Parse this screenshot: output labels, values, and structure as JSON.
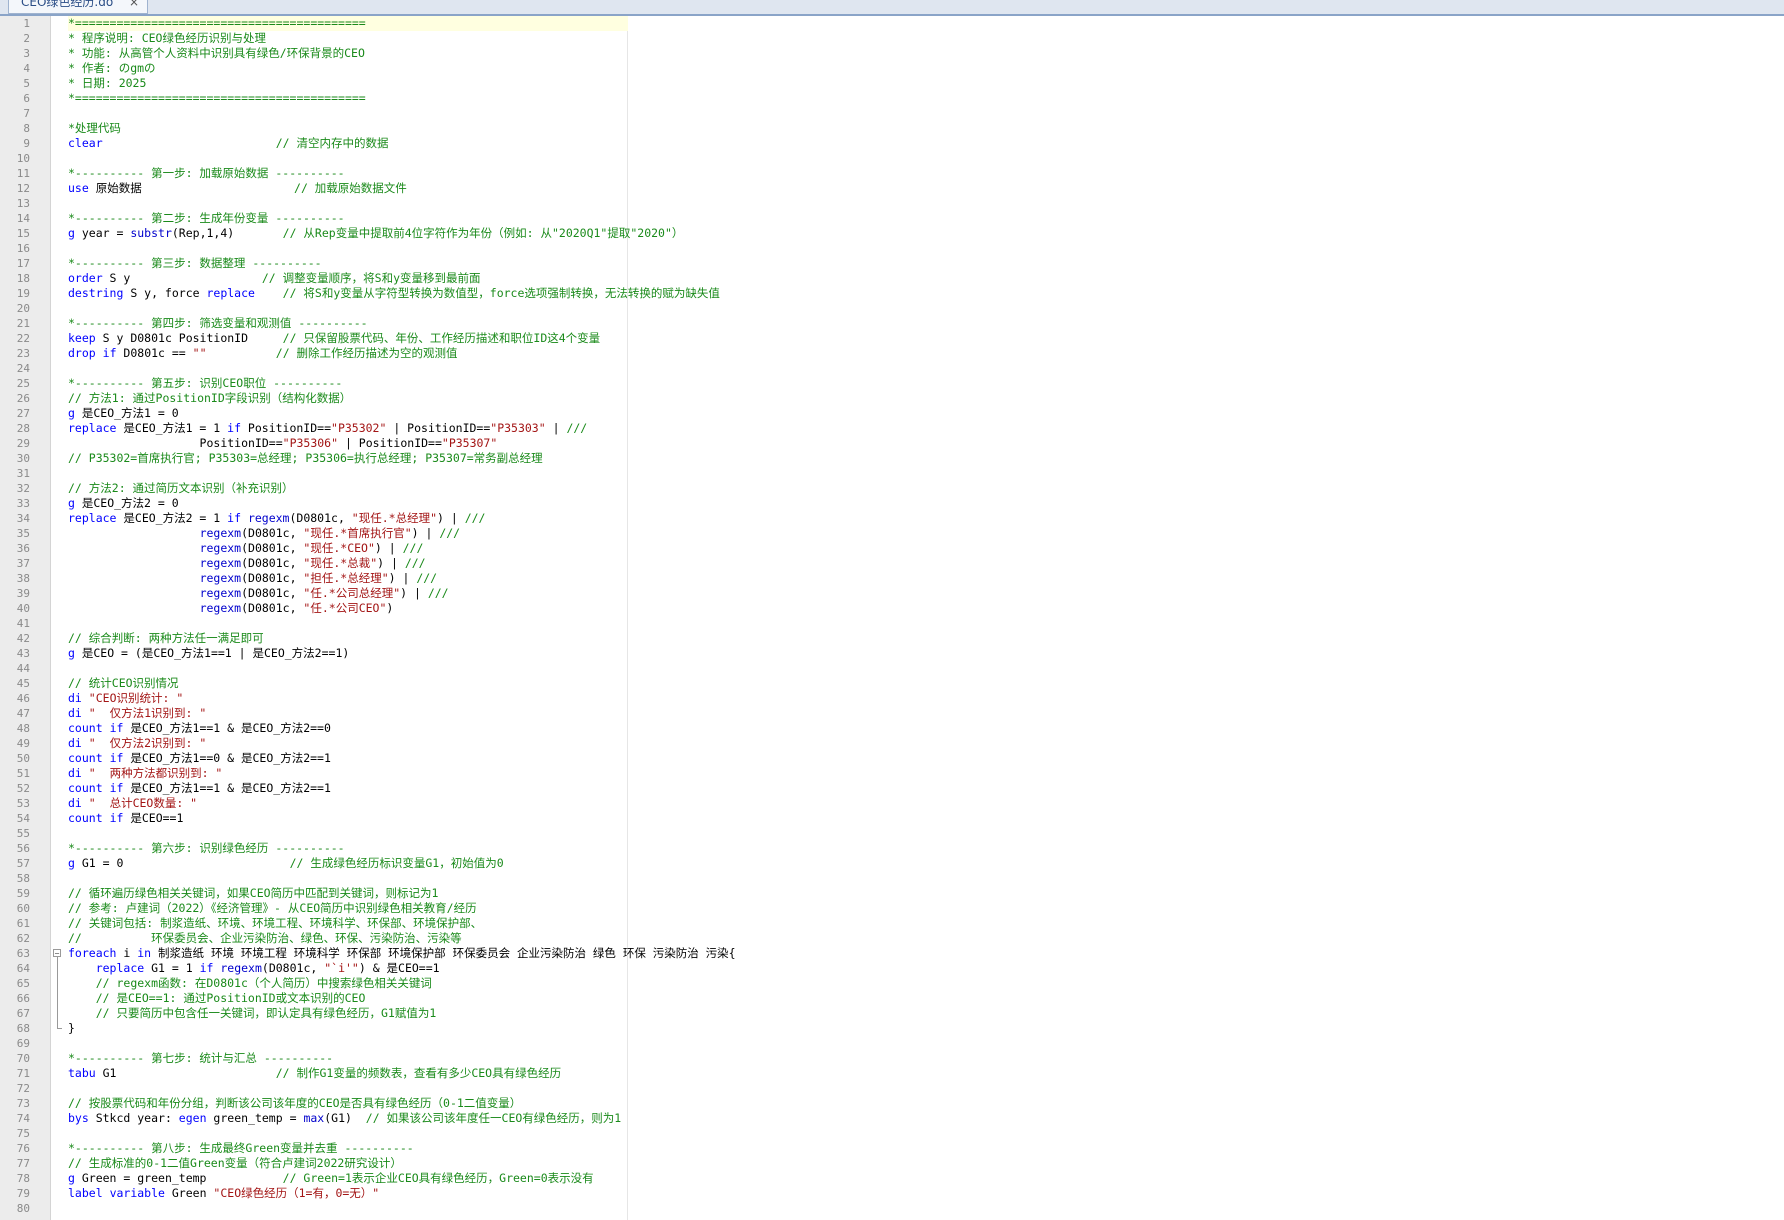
{
  "tab": {
    "title": "CEO绿色经历.do",
    "close": "×"
  },
  "lines": [
    [
      [
        "c",
        "*=========================================="
      ]
    ],
    [
      [
        "c",
        "* 程序说明: CEO绿色经历识别与处理"
      ]
    ],
    [
      [
        "c",
        "* 功能: 从高管个人资料中识别具有绿色/环保背景的CEO"
      ]
    ],
    [
      [
        "c",
        "* 作者: のgmの"
      ]
    ],
    [
      [
        "c",
        "* 日期: 2025"
      ]
    ],
    [
      [
        "c",
        "*=========================================="
      ]
    ],
    [],
    [
      [
        "c",
        "*处理代码"
      ]
    ],
    [
      [
        "k",
        "clear"
      ],
      [
        "t",
        "                         "
      ],
      [
        "c",
        "// 清空内存中的数据"
      ]
    ],
    [],
    [
      [
        "c",
        "*---------- 第一步: 加载原始数据 ----------"
      ]
    ],
    [
      [
        "k",
        "use"
      ],
      [
        "t",
        " 原始数据                      "
      ],
      [
        "c",
        "// 加载原始数据文件"
      ]
    ],
    [],
    [
      [
        "c",
        "*---------- 第二步: 生成年份变量 ----------"
      ]
    ],
    [
      [
        "k",
        "g"
      ],
      [
        "t",
        " year = "
      ],
      [
        "fn",
        "substr"
      ],
      [
        "t",
        "(Rep,1,4)       "
      ],
      [
        "c",
        "// 从Rep变量中提取前4位字符作为年份（例如: 从\"2020Q1\"提取\"2020\"）"
      ]
    ],
    [],
    [
      [
        "c",
        "*---------- 第三步: 数据整理 ----------"
      ]
    ],
    [
      [
        "k",
        "order"
      ],
      [
        "t",
        " S y                   "
      ],
      [
        "c",
        "// 调整变量顺序，将S和y变量移到最前面"
      ]
    ],
    [
      [
        "k",
        "destring"
      ],
      [
        "t",
        " S y, force "
      ],
      [
        "k",
        "replace"
      ],
      [
        "t",
        "    "
      ],
      [
        "c",
        "// 将S和y变量从字符型转换为数值型，force选项强制转换，无法转换的赋为缺失值"
      ]
    ],
    [],
    [
      [
        "c",
        "*---------- 第四步: 筛选变量和观测值 ----------"
      ]
    ],
    [
      [
        "k",
        "keep"
      ],
      [
        "t",
        " S y D0801c PositionID     "
      ],
      [
        "c",
        "// 只保留股票代码、年份、工作经历描述和职位ID这4个变量"
      ]
    ],
    [
      [
        "k",
        "drop"
      ],
      [
        "t",
        " "
      ],
      [
        "k",
        "if"
      ],
      [
        "t",
        " D0801c == "
      ],
      [
        "s",
        "\"\""
      ],
      [
        "t",
        "          "
      ],
      [
        "c",
        "// 删除工作经历描述为空的观测值"
      ]
    ],
    [],
    [
      [
        "c",
        "*---------- 第五步: 识别CEO职位 ----------"
      ]
    ],
    [
      [
        "c",
        "// 方法1: 通过PositionID字段识别（结构化数据）"
      ]
    ],
    [
      [
        "k",
        "g"
      ],
      [
        "t",
        " 是CEO_方法1 = 0"
      ]
    ],
    [
      [
        "k",
        "replace"
      ],
      [
        "t",
        " 是CEO_方法1 = 1 "
      ],
      [
        "k",
        "if"
      ],
      [
        "t",
        " PositionID=="
      ],
      [
        "s",
        "\"P35302\""
      ],
      [
        "t",
        " | PositionID=="
      ],
      [
        "s",
        "\"P35303\""
      ],
      [
        "t",
        " | "
      ],
      [
        "c",
        "///"
      ]
    ],
    [
      [
        "t",
        "                   PositionID=="
      ],
      [
        "s",
        "\"P35306\""
      ],
      [
        "t",
        " | PositionID=="
      ],
      [
        "s",
        "\"P35307\""
      ]
    ],
    [
      [
        "c",
        "// P35302=首席执行官; P35303=总经理; P35306=执行总经理; P35307=常务副总经理"
      ]
    ],
    [],
    [
      [
        "c",
        "// 方法2: 通过简历文本识别（补充识别）"
      ]
    ],
    [
      [
        "k",
        "g"
      ],
      [
        "t",
        " 是CEO_方法2 = 0"
      ]
    ],
    [
      [
        "k",
        "replace"
      ],
      [
        "t",
        " 是CEO_方法2 = 1 "
      ],
      [
        "k",
        "if"
      ],
      [
        "t",
        " "
      ],
      [
        "fn",
        "regexm"
      ],
      [
        "t",
        "(D0801c, "
      ],
      [
        "s",
        "\"现任.*总经理\""
      ],
      [
        "t",
        ") | "
      ],
      [
        "c",
        "///"
      ]
    ],
    [
      [
        "t",
        "                   "
      ],
      [
        "fn",
        "regexm"
      ],
      [
        "t",
        "(D0801c, "
      ],
      [
        "s",
        "\"现任.*首席执行官\""
      ],
      [
        "t",
        ") | "
      ],
      [
        "c",
        "///"
      ]
    ],
    [
      [
        "t",
        "                   "
      ],
      [
        "fn",
        "regexm"
      ],
      [
        "t",
        "(D0801c, "
      ],
      [
        "s",
        "\"现任.*CEO\""
      ],
      [
        "t",
        ") | "
      ],
      [
        "c",
        "///"
      ]
    ],
    [
      [
        "t",
        "                   "
      ],
      [
        "fn",
        "regexm"
      ],
      [
        "t",
        "(D0801c, "
      ],
      [
        "s",
        "\"现任.*总裁\""
      ],
      [
        "t",
        ") | "
      ],
      [
        "c",
        "///"
      ]
    ],
    [
      [
        "t",
        "                   "
      ],
      [
        "fn",
        "regexm"
      ],
      [
        "t",
        "(D0801c, "
      ],
      [
        "s",
        "\"担任.*总经理\""
      ],
      [
        "t",
        ") | "
      ],
      [
        "c",
        "///"
      ]
    ],
    [
      [
        "t",
        "                   "
      ],
      [
        "fn",
        "regexm"
      ],
      [
        "t",
        "(D0801c, "
      ],
      [
        "s",
        "\"任.*公司总经理\""
      ],
      [
        "t",
        ") | "
      ],
      [
        "c",
        "///"
      ]
    ],
    [
      [
        "t",
        "                   "
      ],
      [
        "fn",
        "regexm"
      ],
      [
        "t",
        "(D0801c, "
      ],
      [
        "s",
        "\"任.*公司CEO\""
      ],
      [
        "t",
        ")"
      ]
    ],
    [],
    [
      [
        "c",
        "// 综合判断: 两种方法任一满足即可"
      ]
    ],
    [
      [
        "k",
        "g"
      ],
      [
        "t",
        " 是CEO = (是CEO_方法1==1 | 是CEO_方法2==1)"
      ]
    ],
    [],
    [
      [
        "c",
        "// 统计CEO识别情况"
      ]
    ],
    [
      [
        "k",
        "di"
      ],
      [
        "t",
        " "
      ],
      [
        "s",
        "\"CEO识别统计: \""
      ]
    ],
    [
      [
        "k",
        "di"
      ],
      [
        "t",
        " "
      ],
      [
        "s",
        "\"  仅方法1识别到: \""
      ]
    ],
    [
      [
        "k",
        "count"
      ],
      [
        "t",
        " "
      ],
      [
        "k",
        "if"
      ],
      [
        "t",
        " 是CEO_方法1==1 & 是CEO_方法2==0"
      ]
    ],
    [
      [
        "k",
        "di"
      ],
      [
        "t",
        " "
      ],
      [
        "s",
        "\"  仅方法2识别到: \""
      ]
    ],
    [
      [
        "k",
        "count"
      ],
      [
        "t",
        " "
      ],
      [
        "k",
        "if"
      ],
      [
        "t",
        " 是CEO_方法1==0 & 是CEO_方法2==1"
      ]
    ],
    [
      [
        "k",
        "di"
      ],
      [
        "t",
        " "
      ],
      [
        "s",
        "\"  两种方法都识别到: \""
      ]
    ],
    [
      [
        "k",
        "count"
      ],
      [
        "t",
        " "
      ],
      [
        "k",
        "if"
      ],
      [
        "t",
        " 是CEO_方法1==1 & 是CEO_方法2==1"
      ]
    ],
    [
      [
        "k",
        "di"
      ],
      [
        "t",
        " "
      ],
      [
        "s",
        "\"  总计CEO数量: \""
      ]
    ],
    [
      [
        "k",
        "count"
      ],
      [
        "t",
        " "
      ],
      [
        "k",
        "if"
      ],
      [
        "t",
        " 是CEO==1"
      ]
    ],
    [],
    [
      [
        "c",
        "*---------- 第六步: 识别绿色经历 ----------"
      ]
    ],
    [
      [
        "k",
        "g"
      ],
      [
        "t",
        " G1 = 0                        "
      ],
      [
        "c",
        "// 生成绿色经历标识变量G1，初始值为0"
      ]
    ],
    [],
    [
      [
        "c",
        "// 循环遍历绿色相关关键词，如果CEO简历中匹配到关键词，则标记为1"
      ]
    ],
    [
      [
        "c",
        "// 参考: 卢建词（2022）《经济管理》- 从CEO简历中识别绿色相关教育/经历"
      ]
    ],
    [
      [
        "c",
        "// 关键词包括: 制浆造纸、环境、环境工程、环境科学、环保部、环境保护部、"
      ]
    ],
    [
      [
        "c",
        "//          环保委员会、企业污染防治、绿色、环保、污染防治、污染等"
      ]
    ],
    [
      [
        "k",
        "foreach"
      ],
      [
        "t",
        " i "
      ],
      [
        "k",
        "in"
      ],
      [
        "t",
        " 制浆造纸 环境 环境工程 环境科学 环保部 环境保护部 环保委员会 企业污染防治 绿色 环保 污染防治 污染{"
      ]
    ],
    [
      [
        "t",
        "    "
      ],
      [
        "k",
        "replace"
      ],
      [
        "t",
        " G1 = 1 "
      ],
      [
        "k",
        "if"
      ],
      [
        "t",
        " "
      ],
      [
        "fn",
        "regexm"
      ],
      [
        "t",
        "(D0801c, "
      ],
      [
        "s",
        "\"`i'\""
      ],
      [
        "t",
        ") & 是CEO==1"
      ]
    ],
    [
      [
        "t",
        "    "
      ],
      [
        "c",
        "// regexm函数: 在D0801c（个人简历）中搜索绿色相关关键词"
      ]
    ],
    [
      [
        "t",
        "    "
      ],
      [
        "c",
        "// 是CEO==1: 通过PositionID或文本识别的CEO"
      ]
    ],
    [
      [
        "t",
        "    "
      ],
      [
        "c",
        "// 只要简历中包含任一关键词，即认定具有绿色经历，G1赋值为1"
      ]
    ],
    [
      [
        "t",
        "}"
      ]
    ],
    [],
    [
      [
        "c",
        "*---------- 第七步: 统计与汇总 ----------"
      ]
    ],
    [
      [
        "k",
        "tabu"
      ],
      [
        "t",
        " G1                       "
      ],
      [
        "c",
        "// 制作G1变量的频数表，查看有多少CEO具有绿色经历"
      ]
    ],
    [],
    [
      [
        "c",
        "// 按股票代码和年份分组，判断该公司该年度的CEO是否具有绿色经历（0-1二值变量）"
      ]
    ],
    [
      [
        "k",
        "bys"
      ],
      [
        "t",
        " Stkcd year: "
      ],
      [
        "k",
        "egen"
      ],
      [
        "t",
        " green_temp = "
      ],
      [
        "fn",
        "max"
      ],
      [
        "t",
        "(G1)  "
      ],
      [
        "c",
        "// 如果该公司该年度任一CEO有绿色经历，则为1"
      ]
    ],
    [],
    [
      [
        "c",
        "*---------- 第八步: 生成最终Green变量并去重 ----------"
      ]
    ],
    [
      [
        "c",
        "// 生成标准的0-1二值Green变量（符合卢建词2022研究设计）"
      ]
    ],
    [
      [
        "k",
        "g"
      ],
      [
        "t",
        " Green = green_temp           "
      ],
      [
        "c",
        "// Green=1表示企业CEO具有绿色经历，Green=0表示没有"
      ]
    ],
    [
      [
        "k",
        "label"
      ],
      [
        "t",
        " "
      ],
      [
        "k",
        "variable"
      ],
      [
        "t",
        " Green "
      ],
      [
        "s",
        "\"CEO绿色经历（1=有，0=无）\""
      ]
    ],
    []
  ]
}
